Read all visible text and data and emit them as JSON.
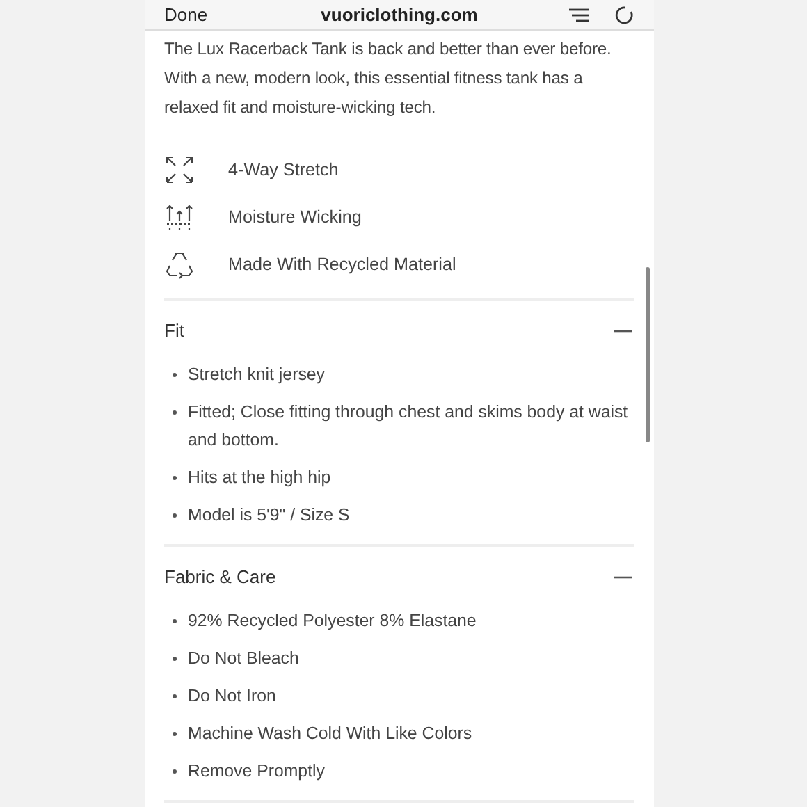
{
  "browser_bar": {
    "done": "Done",
    "address": "vuoriclothing.com"
  },
  "description": "The Lux Racerback Tank is back and better than ever before. With a new, modern look, this essential fitness tank has a relaxed fit and moisture-wicking tech.",
  "features": [
    {
      "kind": "stretch",
      "label": "4-Way Stretch"
    },
    {
      "kind": "wicking",
      "label": "Moisture Wicking"
    },
    {
      "kind": "recycled",
      "label": "Made With Recycled Material"
    }
  ],
  "sections": [
    {
      "title": "Fit",
      "expanded": true,
      "items": [
        "Stretch knit jersey",
        "Fitted; Close fitting through chest and skims body at waist and bottom.",
        "Hits at the high hip",
        "Model is 5'9\" / Size S"
      ]
    },
    {
      "title": "Fabric & Care",
      "expanded": true,
      "items": [
        "92% Recycled Polyester 8% Elastane",
        "Do Not Bleach",
        "Do Not Iron",
        "Machine Wash Cold With Like Colors",
        "Remove Promptly"
      ]
    }
  ]
}
